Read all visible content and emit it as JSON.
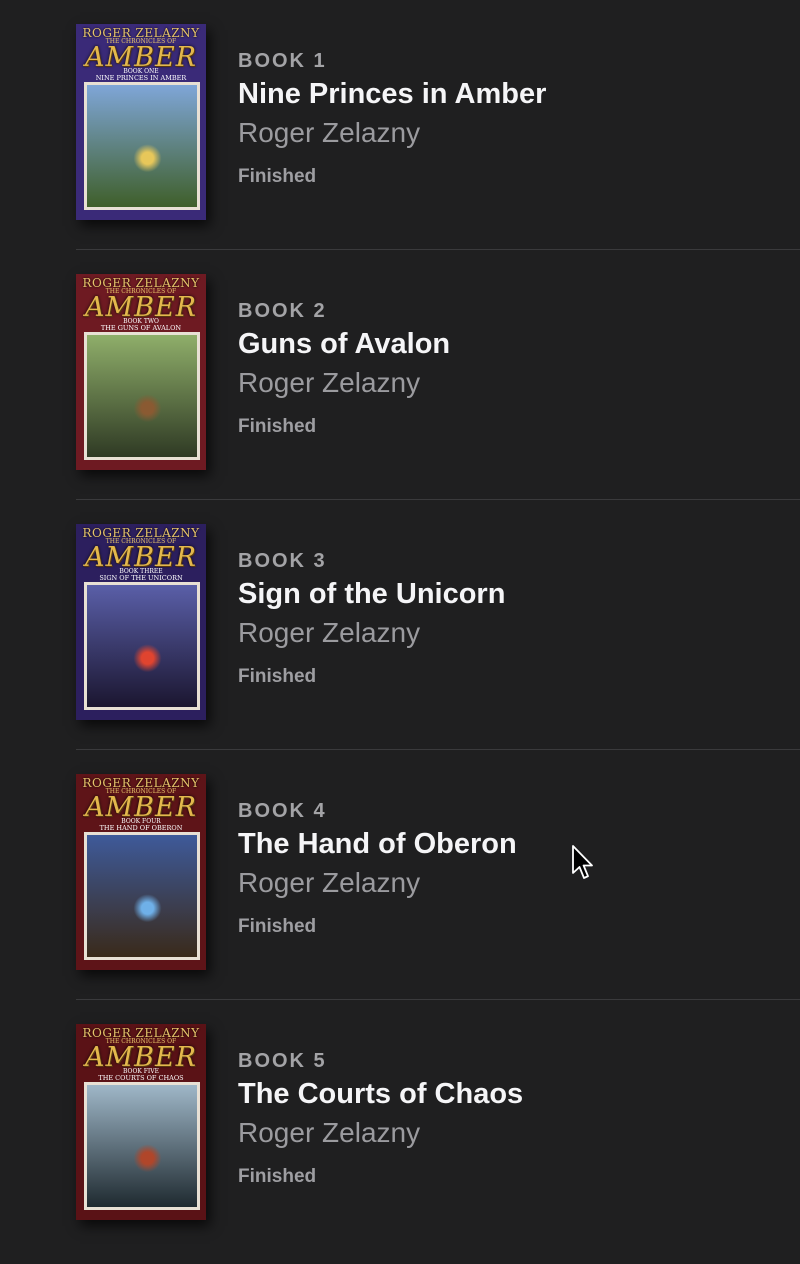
{
  "books": [
    {
      "number_label": "BOOK 1",
      "title": "Nine Princes in Amber",
      "author": "Roger Zelazny",
      "status": "Finished",
      "cover": {
        "author_text": "ROGER ZELAZNY",
        "series_text": "THE CHRONICLES OF",
        "logo_text": "AMBER",
        "book_text": "BOOK ONE",
        "subtitle_text": "NINE PRINCES IN AMBER",
        "bg": "#3a2a78",
        "art_top": "#7fa6d8",
        "art_bottom": "#3f5f2a",
        "accent": "#e7c75a"
      }
    },
    {
      "number_label": "BOOK 2",
      "title": "Guns of Avalon",
      "author": "Roger Zelazny",
      "status": "Finished",
      "cover": {
        "author_text": "ROGER ZELAZNY",
        "series_text": "THE CHRONICLES OF",
        "logo_text": "AMBER",
        "book_text": "BOOK TWO",
        "subtitle_text": "THE GUNS OF AVALON",
        "bg": "#6e1a22",
        "art_top": "#8fae6a",
        "art_bottom": "#2f3a24",
        "accent": "#8a5a32"
      }
    },
    {
      "number_label": "BOOK 3",
      "title": "Sign of the Unicorn",
      "author": "Roger Zelazny",
      "status": "Finished",
      "cover": {
        "author_text": "ROGER ZELAZNY",
        "series_text": "THE CHRONICLES OF",
        "logo_text": "AMBER",
        "book_text": "BOOK THREE",
        "subtitle_text": "SIGN OF THE UNICORN",
        "bg": "#2c1f5e",
        "art_top": "#5a5fa8",
        "art_bottom": "#1b1630",
        "accent": "#e0442f"
      }
    },
    {
      "number_label": "BOOK 4",
      "title": "The Hand of Oberon",
      "author": "Roger Zelazny",
      "status": "Finished",
      "cover": {
        "author_text": "ROGER ZELAZNY",
        "series_text": "THE CHRONICLES OF",
        "logo_text": "AMBER",
        "book_text": "BOOK FOUR",
        "subtitle_text": "THE HAND OF OBERON",
        "bg": "#5e1418",
        "art_top": "#3e5a9a",
        "art_bottom": "#3a2a1a",
        "accent": "#6fb0e8"
      }
    },
    {
      "number_label": "BOOK 5",
      "title": "The Courts of Chaos",
      "author": "Roger Zelazny",
      "status": "Finished",
      "cover": {
        "author_text": "ROGER ZELAZNY",
        "series_text": "THE CHRONICLES OF",
        "logo_text": "AMBER",
        "book_text": "BOOK FIVE",
        "subtitle_text": "THE COURTS OF CHAOS",
        "bg": "#5a1216",
        "art_top": "#9fb7c8",
        "art_bottom": "#1f2a30",
        "accent": "#b0462a"
      }
    }
  ],
  "cursor": {
    "icon": "arrow-cursor-icon"
  }
}
